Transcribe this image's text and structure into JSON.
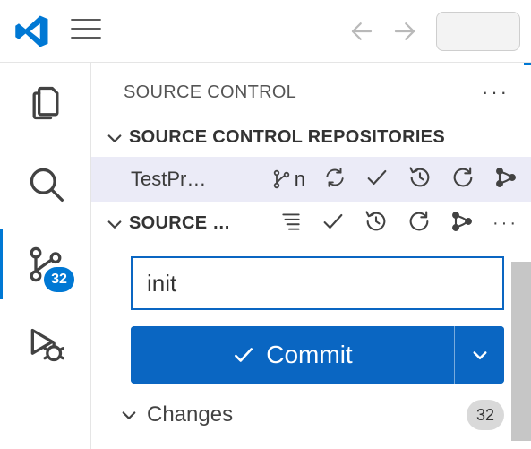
{
  "titlebar": {
    "nav": {
      "back": "←",
      "forward": "→"
    }
  },
  "activitybar": {
    "scm_badge": "32"
  },
  "panel": {
    "title": "SOURCE CONTROL"
  },
  "repositories": {
    "section_title": "SOURCE CONTROL REPOSITORIES",
    "items": [
      {
        "name": "TestPr…",
        "branch": "n"
      }
    ]
  },
  "source_section": {
    "title": "SOURCE …"
  },
  "commit": {
    "message_value": "init",
    "button_label": "Commit"
  },
  "changes": {
    "label": "Changes",
    "count": "32"
  }
}
